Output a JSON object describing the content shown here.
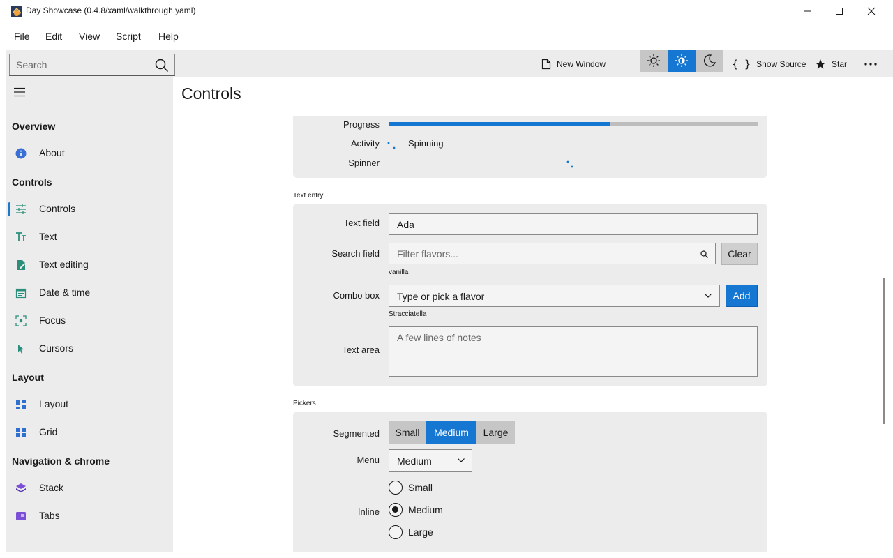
{
  "window": {
    "title": "Day Showcase (0.4.8/xaml/walkthrough.yaml)"
  },
  "menubar": {
    "items": [
      "File",
      "Edit",
      "View",
      "Script",
      "Help"
    ]
  },
  "toolbar": {
    "search_placeholder": "Search",
    "new_window_label": "New Window",
    "show_source_label": "Show Source",
    "star_label": "Star",
    "theme_active": "auto",
    "accent_color": "#1677d2"
  },
  "sidebar": {
    "groups": [
      {
        "heading": "Overview",
        "items": [
          {
            "label": "About",
            "icon": "info-icon"
          }
        ]
      },
      {
        "heading": "Controls",
        "items": [
          {
            "label": "Controls",
            "icon": "sliders-icon",
            "active": true
          },
          {
            "label": "Text",
            "icon": "text-icon"
          },
          {
            "label": "Text editing",
            "icon": "pencil-icon"
          },
          {
            "label": "Date & time",
            "icon": "calendar-icon"
          },
          {
            "label": "Focus",
            "icon": "focus-icon"
          },
          {
            "label": "Cursors",
            "icon": "cursor-icon"
          }
        ]
      },
      {
        "heading": "Layout",
        "items": [
          {
            "label": "Layout",
            "icon": "layout-icon"
          },
          {
            "label": "Grid",
            "icon": "grid-icon"
          }
        ]
      },
      {
        "heading": "Navigation & chrome",
        "items": [
          {
            "label": "Stack",
            "icon": "stack-icon"
          },
          {
            "label": "Tabs",
            "icon": "tabs-icon"
          }
        ]
      }
    ]
  },
  "page": {
    "title": "Controls"
  },
  "status": {
    "progress_label": "Progress",
    "progress_fraction": 0.6,
    "activity_label": "Activity",
    "activity_text": "Spinning",
    "spinner_label": "Spinner"
  },
  "text_entry": {
    "section": "Text entry",
    "text_field_label": "Text field",
    "text_field_value": "Ada",
    "search_field_label": "Search field",
    "search_placeholder": "Filter flavors...",
    "clear_label": "Clear",
    "search_note": "vanilla",
    "combo_label": "Combo box",
    "combo_placeholder": "Type or pick a flavor",
    "add_label": "Add",
    "combo_note": "Stracciatella",
    "textarea_label": "Text area",
    "textarea_placeholder": "A few lines of notes"
  },
  "pickers": {
    "section": "Pickers",
    "segmented_label": "Segmented",
    "segments": [
      "Small",
      "Medium",
      "Large"
    ],
    "segment_selected": "Medium",
    "menu_label": "Menu",
    "menu_value": "Medium",
    "inline_label": "Inline",
    "radios": [
      "Small",
      "Medium",
      "Large"
    ],
    "radio_selected": "Medium"
  }
}
